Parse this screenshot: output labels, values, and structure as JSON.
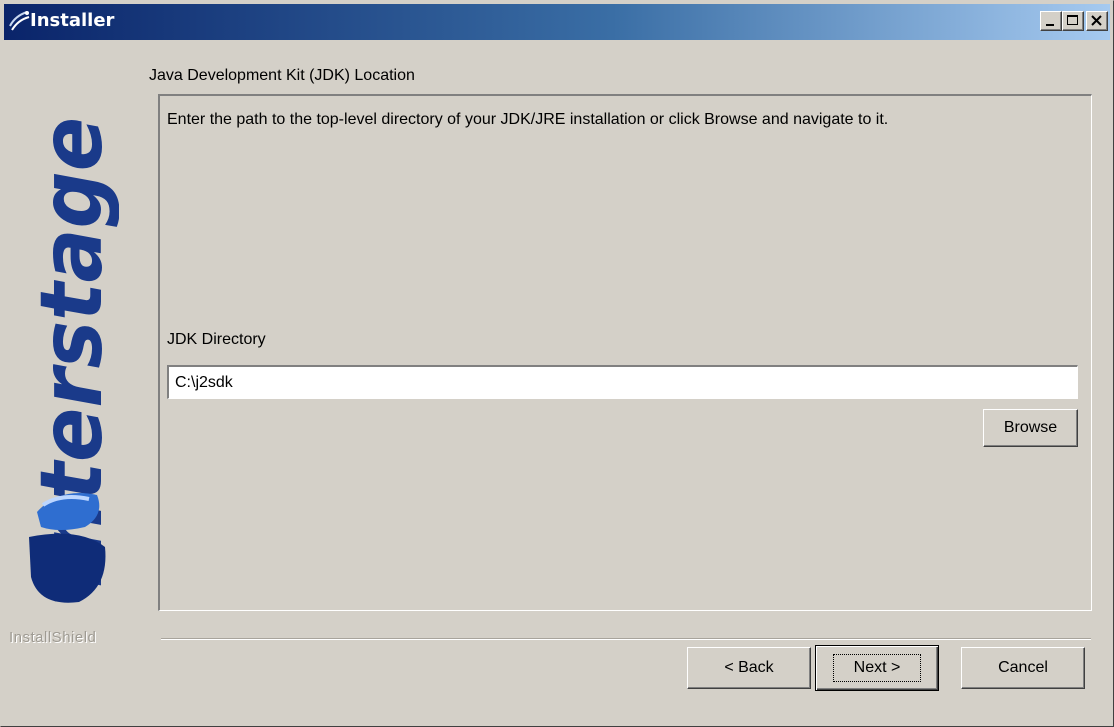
{
  "window": {
    "title": "Installer",
    "controls": {
      "minimize": "minimize-icon",
      "maximize": "maximize-icon",
      "close": "close-icon"
    }
  },
  "branding": {
    "logo_text": "Interstage",
    "footer": "InstallShield"
  },
  "page": {
    "title": "Java Development Kit (JDK) Location",
    "instructions": "Enter the path to the top-level directory of your JDK/JRE installation or click Browse and navigate to it."
  },
  "jdk": {
    "label": "JDK Directory",
    "value": "C:\\j2sdk",
    "browse_label": "Browse"
  },
  "buttons": {
    "back": "< Back",
    "next": "Next >",
    "cancel": "Cancel"
  },
  "colors": {
    "title_bar": "#0a246a",
    "logo_blue": "#1a3a8a",
    "face": "#d4d0c8"
  }
}
